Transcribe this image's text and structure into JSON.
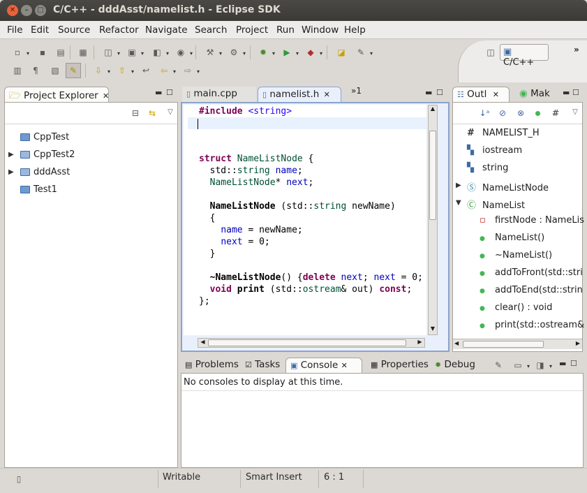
{
  "window": {
    "title": "C/C++ - dddAsst/namelist.h - Eclipse SDK"
  },
  "menu": [
    "File",
    "Edit",
    "Source",
    "Refactor",
    "Navigate",
    "Search",
    "Project",
    "Run",
    "Window",
    "Help"
  ],
  "perspective": {
    "label": "C/C++"
  },
  "project_explorer": {
    "tab_label": "Project Explorer",
    "items": [
      {
        "label": "CppTest",
        "expandable": false
      },
      {
        "label": "CppTest2",
        "expandable": true
      },
      {
        "label": "dddAsst",
        "expandable": true
      },
      {
        "label": "Test1",
        "expandable": false
      }
    ]
  },
  "editor": {
    "tabs": [
      {
        "label": "main.cpp",
        "active": false
      },
      {
        "label": "namelist.h",
        "active": true
      }
    ],
    "overflow": "»1",
    "lines": [
      "#include <string>",
      "",
      "",
      "",
      "struct NameListNode {",
      "  std::string name;",
      "  NameListNode* next;",
      "",
      "  NameListNode (std::string newName)",
      "  {",
      "    name = newName;",
      "    next = 0;",
      "  }",
      "",
      "  ~NameListNode() {delete next; next = 0;",
      "  void print (std::ostream& out) const;",
      "};"
    ]
  },
  "outline": {
    "tabs": [
      {
        "label": "Outl",
        "active": true
      },
      {
        "label": "Mak",
        "active": false
      }
    ],
    "items": [
      {
        "label": "NAMELIST_H",
        "icon": "macro-icon"
      },
      {
        "label": "iostream",
        "icon": "include-icon"
      },
      {
        "label": "string",
        "icon": "include-icon"
      },
      {
        "label": "NameListNode",
        "icon": "struct-icon"
      },
      {
        "label": "NameList",
        "icon": "class-icon"
      },
      {
        "label": "firstNode : NameLis",
        "icon": "private-field-icon"
      },
      {
        "label": "NameList()",
        "icon": "public-method-icon"
      },
      {
        "label": "~NameList()",
        "icon": "public-method-icon"
      },
      {
        "label": "addToFront(std::stri",
        "icon": "public-method-icon"
      },
      {
        "label": "addToEnd(std::strin",
        "icon": "public-method-icon"
      },
      {
        "label": "clear() : void",
        "icon": "public-method-icon"
      },
      {
        "label": "print(std::ostream&",
        "icon": "const-method-icon"
      }
    ]
  },
  "bottom": {
    "tabs": [
      "Problems",
      "Tasks",
      "Console",
      "Properties",
      "Debug"
    ],
    "active_tab": "Console",
    "message": "No consoles to display at this time."
  },
  "statusbar": {
    "writable": "Writable",
    "insert_mode": "Smart Insert",
    "position": "6 : 1"
  },
  "colors": {
    "keyword": "#7f0055",
    "type": "#005032",
    "field": "#0000c0",
    "string": "#2a00ff",
    "method_dot": "#44b655"
  }
}
